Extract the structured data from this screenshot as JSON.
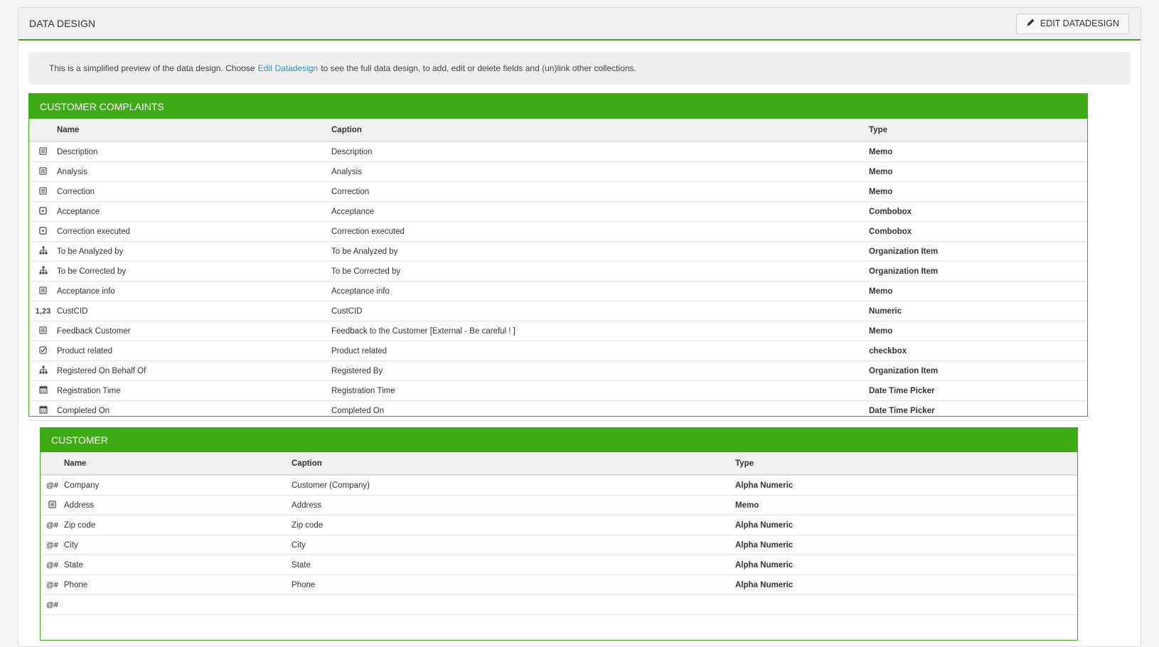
{
  "header": {
    "title": "DATA DESIGN",
    "edit_label": "EDIT DATADESIGN"
  },
  "info": {
    "before": "This is a simplified preview of the data design. Choose",
    "link": "Edit Datadesign",
    "after": "to see the full data design, to add, edit or delete fields and (un)link other collections."
  },
  "complaints": {
    "title": "CUSTOMER COMPLAINTS",
    "columns": {
      "name": "Name",
      "caption": "Caption",
      "type": "Type"
    },
    "rows": [
      {
        "icon": "memo-icon",
        "name": "Description",
        "caption": "Description",
        "type": "Memo"
      },
      {
        "icon": "memo-icon",
        "name": "Analysis",
        "caption": "Analysis",
        "type": "Memo"
      },
      {
        "icon": "memo-icon",
        "name": "Correction",
        "caption": "Correction",
        "type": "Memo"
      },
      {
        "icon": "combobox-icon",
        "name": "Acceptance",
        "caption": "Acceptance",
        "type": "Combobox"
      },
      {
        "icon": "combobox-icon",
        "name": "Correction executed",
        "caption": "Correction executed",
        "type": "Combobox"
      },
      {
        "icon": "org-icon",
        "name": "To be Analyzed by",
        "caption": "To be Analyzed by",
        "type": "Organization Item"
      },
      {
        "icon": "org-icon",
        "name": "To be Corrected by",
        "caption": "To be Corrected by",
        "type": "Organization Item"
      },
      {
        "icon": "memo-icon",
        "name": "Acceptance info",
        "caption": "Acceptance info",
        "type": "Memo"
      },
      {
        "icon": "numeric-icon",
        "icon_text": "1,23",
        "name": "CustCID",
        "caption": "CustCID",
        "type": "Numeric"
      },
      {
        "icon": "memo-icon",
        "name": "Feedback Customer",
        "caption": "Feedback to the Customer [External - Be careful ! ]",
        "type": "Memo"
      },
      {
        "icon": "checkbox-icon",
        "name": "Product related",
        "caption": "Product related",
        "type": "checkbox"
      },
      {
        "icon": "org-icon",
        "name": "Registered On Behalf Of",
        "caption": "Registered By",
        "type": "Organization Item"
      },
      {
        "icon": "calendar-icon",
        "name": "Registration Time",
        "caption": "Registration Time",
        "type": "Date Time Picker"
      },
      {
        "icon": "calendar-icon",
        "name": "Completed On",
        "caption": "Completed On",
        "type": "Date Time Picker"
      }
    ]
  },
  "customer": {
    "title": "CUSTOMER",
    "columns": {
      "name": "Name",
      "caption": "Caption",
      "type": "Type"
    },
    "rows": [
      {
        "icon": "alphanumeric-icon",
        "icon_text": "@#",
        "name": "Company",
        "caption": "Customer (Company)",
        "type": "Alpha Numeric"
      },
      {
        "icon": "memo-icon",
        "name": "Address",
        "caption": "Address",
        "type": "Memo"
      },
      {
        "icon": "alphanumeric-icon",
        "icon_text": "@#",
        "name": "Zip code",
        "caption": "Zip code",
        "type": "Alpha Numeric"
      },
      {
        "icon": "alphanumeric-icon",
        "icon_text": "@#",
        "name": "City",
        "caption": "City",
        "type": "Alpha Numeric"
      },
      {
        "icon": "alphanumeric-icon",
        "icon_text": "@#",
        "name": "State",
        "caption": "State",
        "type": "Alpha Numeric"
      },
      {
        "icon": "alphanumeric-icon",
        "icon_text": "@#",
        "name": "Phone",
        "caption": "Phone",
        "type": "Alpha Numeric"
      },
      {
        "icon": "alphanumeric-icon",
        "icon_text": "@#",
        "name": "",
        "caption": "",
        "type": ""
      }
    ]
  }
}
